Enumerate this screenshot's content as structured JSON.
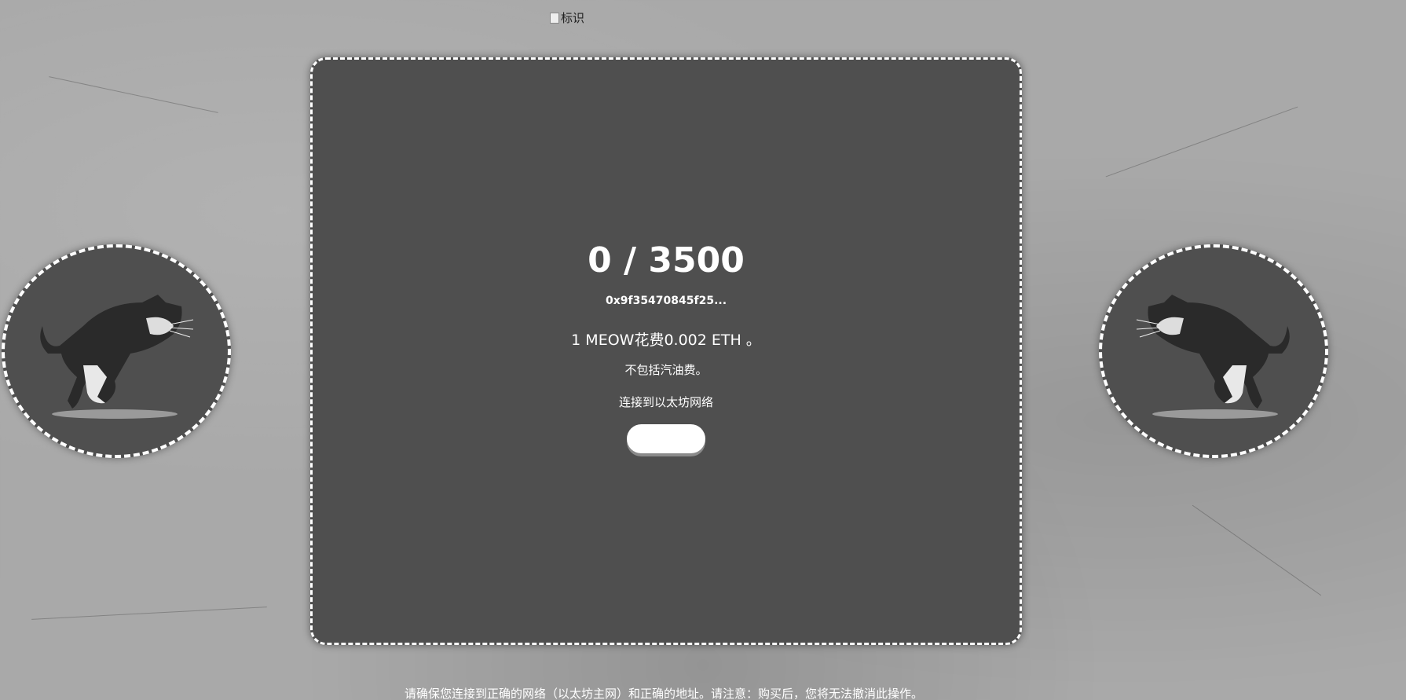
{
  "header": {
    "logo_alt": "标识"
  },
  "mint": {
    "counter": "0 / 3500",
    "contract_address": "0x9f35470845f25...",
    "price_text": "1 MEOW花费0.002 ETH 。",
    "gas_note": "不包括汽油费。",
    "network_prompt": "连接到以太坊网络",
    "button_label": ""
  },
  "footer": {
    "notice": "请确保您连接到正确的网络（以太坊主网）和正确的地址。请注意：购买后，您将无法撤消此操作。"
  },
  "colors": {
    "page_background": "#a9a9a9",
    "panel_background": "#4f4f4f",
    "border": "#ffffff",
    "text": "#ffffff"
  }
}
